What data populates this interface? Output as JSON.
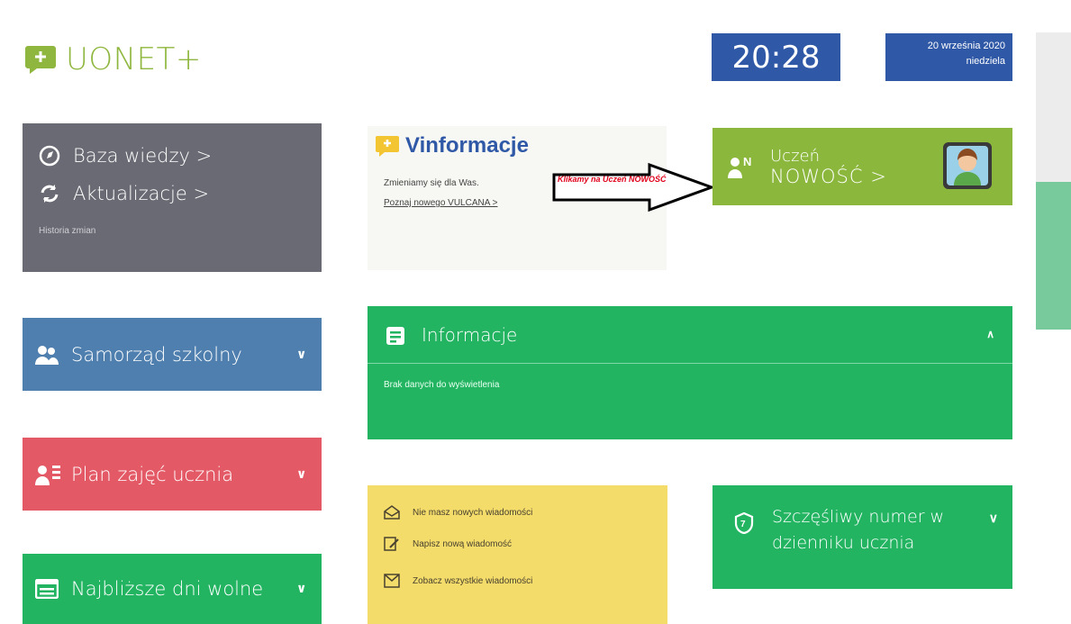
{
  "header": {
    "logo_text": "UONET+",
    "time": "20:28",
    "date_line1": "20 września 2020",
    "date_line2": "niedziela"
  },
  "left": {
    "baza_wiedzy": "Baza wiedzy >",
    "aktualizacje": "Aktualizacje >",
    "historia": "Historia zmian",
    "samorzad": "Samorząd szkolny",
    "plan": "Plan zajęć ucznia",
    "dni_wolne": "Najbliższe dni wolne"
  },
  "vinformacje": {
    "title": "Vinformacje",
    "line1": "Zmieniamy się dla Was.",
    "link": "Poznaj nowego VULCANA >",
    "annotation": "Klikamy na Uczeń NOWOŚĆ"
  },
  "uczen": {
    "line1": "Uczeń",
    "line2": "NOWOŚĆ >",
    "badge": "N"
  },
  "informacje": {
    "title": "Informacje",
    "empty": "Brak danych do wyświetlenia"
  },
  "messages": {
    "items": [
      "Nie masz nowych wiadomości",
      "Napisz nową wiadomość",
      "Zobacz wszystkie wiadomości"
    ]
  },
  "lucky": {
    "text": "Szczęśliwy numer w dzienniku ucznia"
  },
  "colors": {
    "blue": "#2f58a6",
    "green": "#23b462",
    "olive": "#8bb73c",
    "gray": "#696a73",
    "steel": "#4f7fae",
    "red": "#e35966",
    "yellow": "#f3dc6a"
  }
}
